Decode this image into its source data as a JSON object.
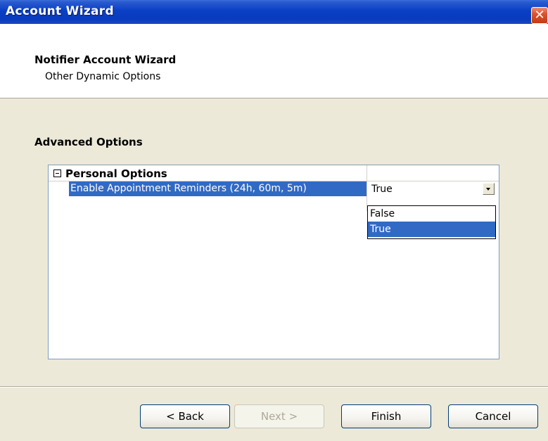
{
  "window": {
    "title": "Account Wizard",
    "close_glyph": "✕",
    "close_icon": "close-icon"
  },
  "header": {
    "title": "Notifier Account Wizard",
    "subtitle": "Other Dynamic Options"
  },
  "section": {
    "title": "Advanced Options"
  },
  "property_grid": {
    "category": {
      "label": "Personal Options",
      "expander_icon": "collapse-icon",
      "expanded": true
    },
    "properties": [
      {
        "name": "Enable Appointment Reminders (24h, 60m, 5m)",
        "value": "True"
      }
    ],
    "dropdown": {
      "open": true,
      "options": [
        "False",
        "True"
      ],
      "selected": "True"
    }
  },
  "buttons": {
    "back": "< Back",
    "next": "Next >",
    "finish": "Finish",
    "cancel": "Cancel"
  },
  "colors": {
    "title_bar": "#0a3fc4",
    "selection": "#316ac5",
    "dialog_bg": "#ece9d8",
    "close_button": "#d9532f"
  }
}
